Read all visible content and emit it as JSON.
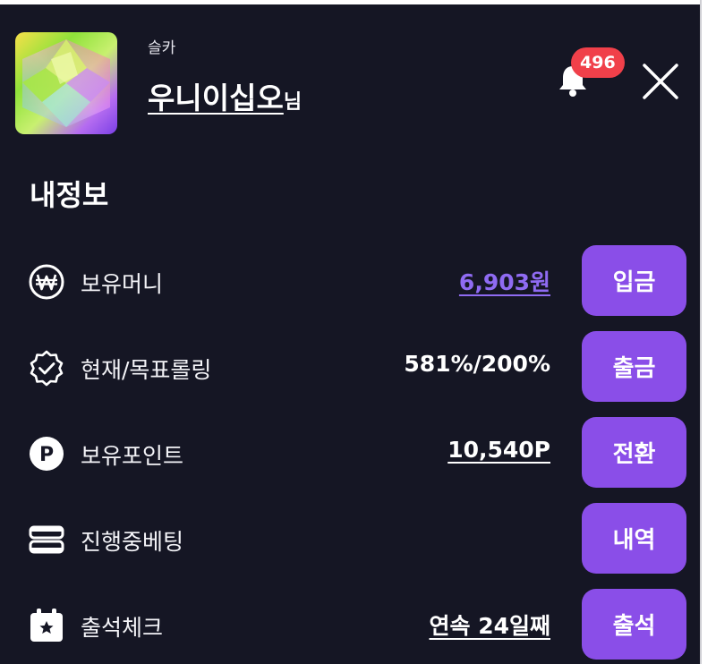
{
  "header": {
    "sub_name": "슬카",
    "user_name": "우니이십오",
    "user_suffix": "님",
    "notification_count": "496",
    "avatar_icon": "gem-icon",
    "bell_icon": "bell-icon",
    "close_icon": "close-icon"
  },
  "section_title": "내정보",
  "rows": [
    {
      "icon": "won-icon",
      "label": "보유머니",
      "value": "6,903원",
      "button": "입금"
    },
    {
      "icon": "badge-check-icon",
      "label": "현재/목표롤링",
      "value": "581%/200%",
      "button": "출금"
    },
    {
      "icon": "point-icon",
      "label": "보유포인트",
      "value": "10,540P",
      "button": "전환"
    },
    {
      "icon": "betting-icon",
      "label": "진행중베팅",
      "value": "",
      "button": "내역"
    },
    {
      "icon": "calendar-star-icon",
      "label": "출석체크",
      "value": "연속 24일째",
      "button": "출석"
    }
  ],
  "colors": {
    "background": "#151624",
    "button": "#8a4ee8",
    "money_value": "#8f6bf2",
    "badge": "#f0404a"
  }
}
